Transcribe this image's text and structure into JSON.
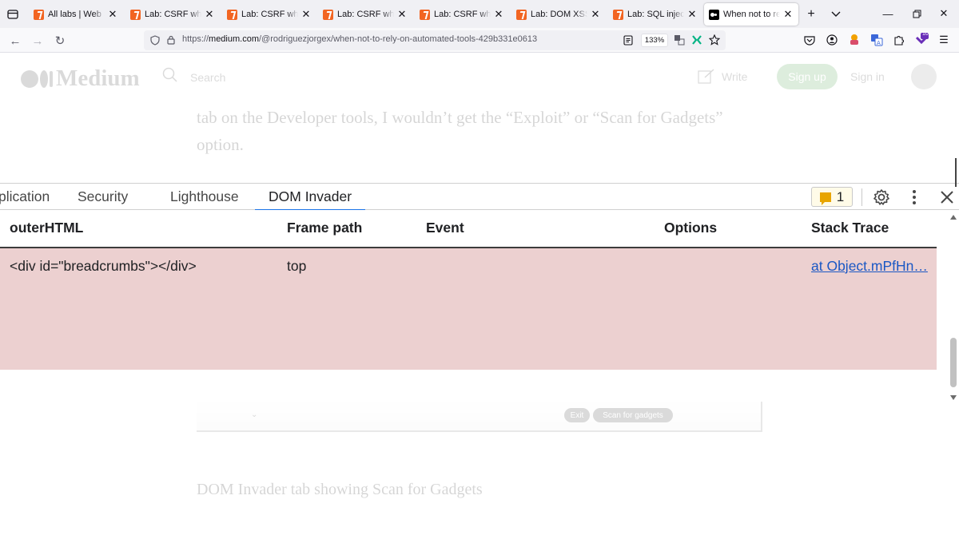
{
  "browser": {
    "tabs": [
      {
        "label": "All labs | Web Security Academy",
        "icon": "portswigger-icon",
        "active": false
      },
      {
        "label": "Lab: CSRF where token validation",
        "icon": "portswigger-icon",
        "active": false
      },
      {
        "label": "Lab: CSRF where token is tied",
        "icon": "portswigger-icon",
        "active": false
      },
      {
        "label": "Lab: CSRF where token is duplicated",
        "icon": "portswigger-icon",
        "active": false
      },
      {
        "label": "Lab: CSRF where token validation",
        "icon": "portswigger-icon",
        "active": false
      },
      {
        "label": "Lab: DOM XSS in AngularJS",
        "icon": "portswigger-icon",
        "active": false
      },
      {
        "label": "Lab: SQL injection vulnerability",
        "icon": "portswigger-icon",
        "active": false
      },
      {
        "label": "When not to rely on automated tools",
        "icon": "medium-icon",
        "active": true
      }
    ],
    "url": {
      "prefix": "https://",
      "host": "medium.com",
      "path": "/@rodriguezjorgex/when-not-to-rely-on-automated-tools-429b331e0613"
    },
    "zoom": "133%",
    "extension_badge": "10"
  },
  "medium": {
    "logo_text": "Medium",
    "search_placeholder": "Search",
    "write_label": "Write",
    "signup_label": "Sign up",
    "signin_label": "Sign in",
    "article_line_1": "tab on the Developer tools, I wouldn’t get the “Exploit” or “Scan for Gadgets”",
    "article_line_2": "option.",
    "image_pill_1": "Exit",
    "image_pill_2": "Scan for gadgets",
    "caption": "DOM Invader tab showing Scan for Gadgets"
  },
  "devtools": {
    "tabs": [
      {
        "label": "Application",
        "visible_label": "plication",
        "active": false
      },
      {
        "label": "Security",
        "active": false
      },
      {
        "label": "Lighthouse",
        "active": false
      },
      {
        "label": "DOM Invader",
        "active": true
      }
    ],
    "issues_count": "1",
    "table": {
      "columns": [
        "outerHTML",
        "Frame path",
        "Event",
        "Options",
        "Stack Trace"
      ],
      "rows": [
        {
          "outerHTML": "<div id=\"breadcrumbs\"></div>",
          "frame_path": "top",
          "event": "",
          "options": "",
          "stack_trace": "at Object.mPfHn…"
        }
      ]
    },
    "row_highlight_color": "#ecd0d0",
    "active_tab_color": "#1a73e8"
  }
}
